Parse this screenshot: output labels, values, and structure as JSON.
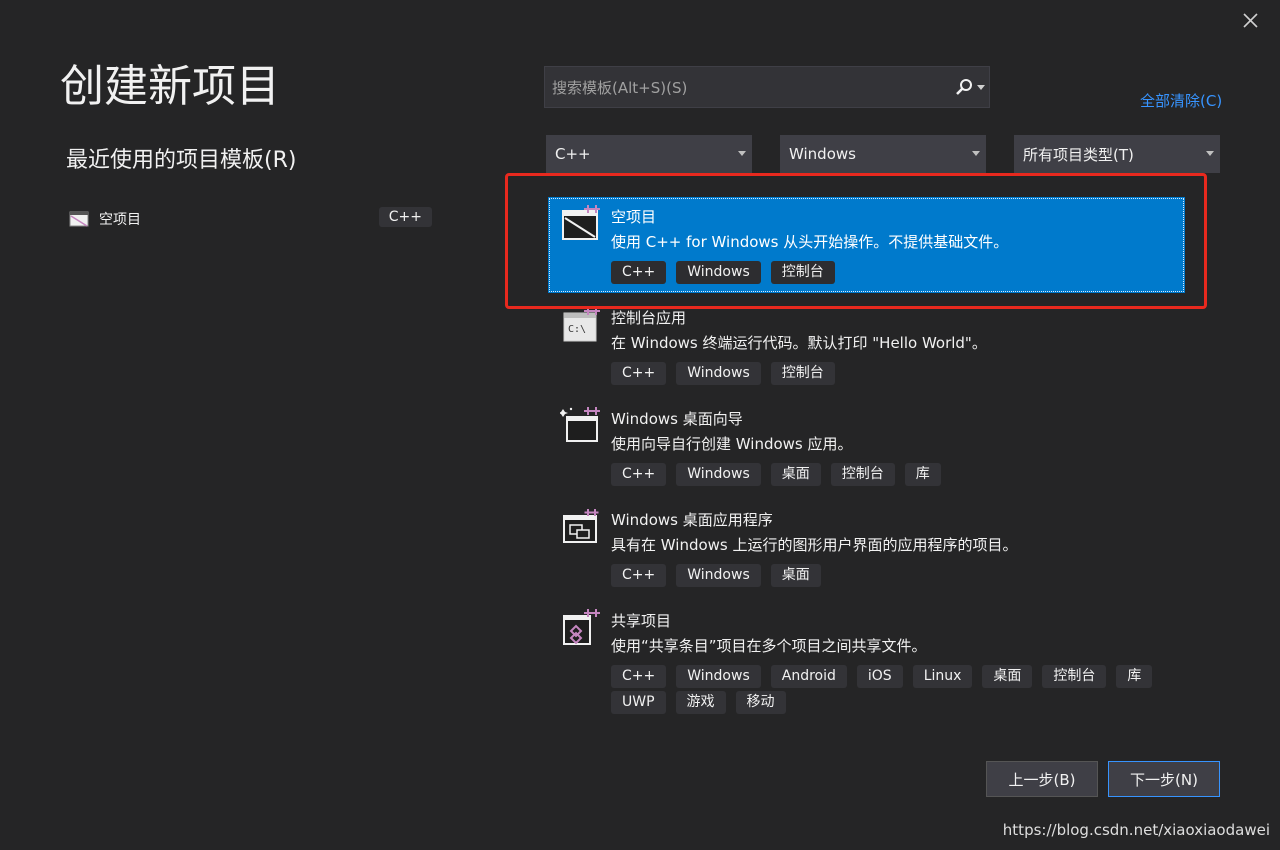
{
  "page": {
    "title": "创建新项目",
    "recent_title": "最近使用的项目模板(R)",
    "close_icon": "close-icon"
  },
  "recent": [
    {
      "label": "空项目",
      "tag": "C++",
      "icon": "empty-project-icon"
    }
  ],
  "search": {
    "placeholder": "搜索模板(Alt+S)(S)",
    "value": "",
    "icon": "search-icon"
  },
  "clear_all": "全部清除(C)",
  "filters": {
    "language": "C++",
    "platform": "Windows",
    "project_type": "所有项目类型(T)"
  },
  "templates": [
    {
      "name": "空项目",
      "desc": "使用 C++ for Windows 从头开始操作。不提供基础文件。",
      "tags": [
        "C++",
        "Windows",
        "控制台"
      ],
      "icon": "empty-project-icon",
      "selected": true
    },
    {
      "name": "控制台应用",
      "desc": "在 Windows 终端运行代码。默认打印 \"Hello World\"。",
      "tags": [
        "C++",
        "Windows",
        "控制台"
      ],
      "icon": "console-app-icon",
      "selected": false
    },
    {
      "name": "Windows 桌面向导",
      "desc": "使用向导自行创建 Windows 应用。",
      "tags": [
        "C++",
        "Windows",
        "桌面",
        "控制台",
        "库"
      ],
      "icon": "desktop-wizard-icon",
      "selected": false
    },
    {
      "name": "Windows 桌面应用程序",
      "desc": "具有在 Windows 上运行的图形用户界面的应用程序的项目。",
      "tags": [
        "C++",
        "Windows",
        "桌面"
      ],
      "icon": "desktop-app-icon",
      "selected": false
    },
    {
      "name": "共享项目",
      "desc": "使用“共享条目”项目在多个项目之间共享文件。",
      "tags": [
        "C++",
        "Windows",
        "Android",
        "iOS",
        "Linux",
        "桌面",
        "控制台",
        "库",
        "UWP",
        "游戏",
        "移动"
      ],
      "icon": "shared-project-icon",
      "selected": false
    }
  ],
  "buttons": {
    "back": "上一步(B)",
    "next": "下一步(N)"
  },
  "watermark": "https://blog.csdn.net/xiaoxiaodawei",
  "colors": {
    "background": "#252526",
    "selection": "#007acc",
    "link": "#3794ff",
    "highlight": "#e8291e",
    "accent_icon": "#c586c0"
  }
}
